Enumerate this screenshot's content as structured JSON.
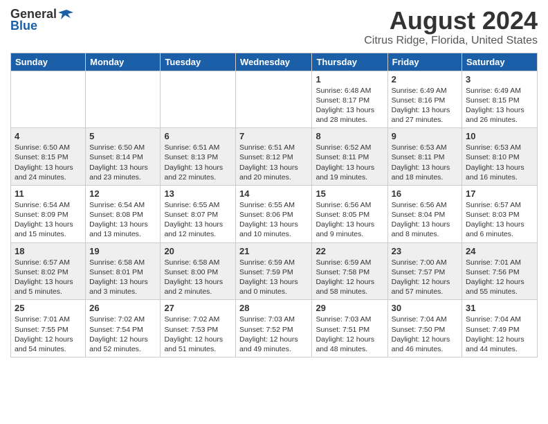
{
  "header": {
    "logo_general": "General",
    "logo_blue": "Blue",
    "main_title": "August 2024",
    "subtitle": "Citrus Ridge, Florida, United States"
  },
  "calendar": {
    "columns": [
      "Sunday",
      "Monday",
      "Tuesday",
      "Wednesday",
      "Thursday",
      "Friday",
      "Saturday"
    ],
    "weeks": [
      [
        {
          "day": "",
          "info": ""
        },
        {
          "day": "",
          "info": ""
        },
        {
          "day": "",
          "info": ""
        },
        {
          "day": "",
          "info": ""
        },
        {
          "day": "1",
          "info": "Sunrise: 6:48 AM\nSunset: 8:17 PM\nDaylight: 13 hours\nand 28 minutes."
        },
        {
          "day": "2",
          "info": "Sunrise: 6:49 AM\nSunset: 8:16 PM\nDaylight: 13 hours\nand 27 minutes."
        },
        {
          "day": "3",
          "info": "Sunrise: 6:49 AM\nSunset: 8:15 PM\nDaylight: 13 hours\nand 26 minutes."
        }
      ],
      [
        {
          "day": "4",
          "info": "Sunrise: 6:50 AM\nSunset: 8:15 PM\nDaylight: 13 hours\nand 24 minutes."
        },
        {
          "day": "5",
          "info": "Sunrise: 6:50 AM\nSunset: 8:14 PM\nDaylight: 13 hours\nand 23 minutes."
        },
        {
          "day": "6",
          "info": "Sunrise: 6:51 AM\nSunset: 8:13 PM\nDaylight: 13 hours\nand 22 minutes."
        },
        {
          "day": "7",
          "info": "Sunrise: 6:51 AM\nSunset: 8:12 PM\nDaylight: 13 hours\nand 20 minutes."
        },
        {
          "day": "8",
          "info": "Sunrise: 6:52 AM\nSunset: 8:11 PM\nDaylight: 13 hours\nand 19 minutes."
        },
        {
          "day": "9",
          "info": "Sunrise: 6:53 AM\nSunset: 8:11 PM\nDaylight: 13 hours\nand 18 minutes."
        },
        {
          "day": "10",
          "info": "Sunrise: 6:53 AM\nSunset: 8:10 PM\nDaylight: 13 hours\nand 16 minutes."
        }
      ],
      [
        {
          "day": "11",
          "info": "Sunrise: 6:54 AM\nSunset: 8:09 PM\nDaylight: 13 hours\nand 15 minutes."
        },
        {
          "day": "12",
          "info": "Sunrise: 6:54 AM\nSunset: 8:08 PM\nDaylight: 13 hours\nand 13 minutes."
        },
        {
          "day": "13",
          "info": "Sunrise: 6:55 AM\nSunset: 8:07 PM\nDaylight: 13 hours\nand 12 minutes."
        },
        {
          "day": "14",
          "info": "Sunrise: 6:55 AM\nSunset: 8:06 PM\nDaylight: 13 hours\nand 10 minutes."
        },
        {
          "day": "15",
          "info": "Sunrise: 6:56 AM\nSunset: 8:05 PM\nDaylight: 13 hours\nand 9 minutes."
        },
        {
          "day": "16",
          "info": "Sunrise: 6:56 AM\nSunset: 8:04 PM\nDaylight: 13 hours\nand 8 minutes."
        },
        {
          "day": "17",
          "info": "Sunrise: 6:57 AM\nSunset: 8:03 PM\nDaylight: 13 hours\nand 6 minutes."
        }
      ],
      [
        {
          "day": "18",
          "info": "Sunrise: 6:57 AM\nSunset: 8:02 PM\nDaylight: 13 hours\nand 5 minutes."
        },
        {
          "day": "19",
          "info": "Sunrise: 6:58 AM\nSunset: 8:01 PM\nDaylight: 13 hours\nand 3 minutes."
        },
        {
          "day": "20",
          "info": "Sunrise: 6:58 AM\nSunset: 8:00 PM\nDaylight: 13 hours\nand 2 minutes."
        },
        {
          "day": "21",
          "info": "Sunrise: 6:59 AM\nSunset: 7:59 PM\nDaylight: 13 hours\nand 0 minutes."
        },
        {
          "day": "22",
          "info": "Sunrise: 6:59 AM\nSunset: 7:58 PM\nDaylight: 12 hours\nand 58 minutes."
        },
        {
          "day": "23",
          "info": "Sunrise: 7:00 AM\nSunset: 7:57 PM\nDaylight: 12 hours\nand 57 minutes."
        },
        {
          "day": "24",
          "info": "Sunrise: 7:01 AM\nSunset: 7:56 PM\nDaylight: 12 hours\nand 55 minutes."
        }
      ],
      [
        {
          "day": "25",
          "info": "Sunrise: 7:01 AM\nSunset: 7:55 PM\nDaylight: 12 hours\nand 54 minutes."
        },
        {
          "day": "26",
          "info": "Sunrise: 7:02 AM\nSunset: 7:54 PM\nDaylight: 12 hours\nand 52 minutes."
        },
        {
          "day": "27",
          "info": "Sunrise: 7:02 AM\nSunset: 7:53 PM\nDaylight: 12 hours\nand 51 minutes."
        },
        {
          "day": "28",
          "info": "Sunrise: 7:03 AM\nSunset: 7:52 PM\nDaylight: 12 hours\nand 49 minutes."
        },
        {
          "day": "29",
          "info": "Sunrise: 7:03 AM\nSunset: 7:51 PM\nDaylight: 12 hours\nand 48 minutes."
        },
        {
          "day": "30",
          "info": "Sunrise: 7:04 AM\nSunset: 7:50 PM\nDaylight: 12 hours\nand 46 minutes."
        },
        {
          "day": "31",
          "info": "Sunrise: 7:04 AM\nSunset: 7:49 PM\nDaylight: 12 hours\nand 44 minutes."
        }
      ]
    ]
  }
}
